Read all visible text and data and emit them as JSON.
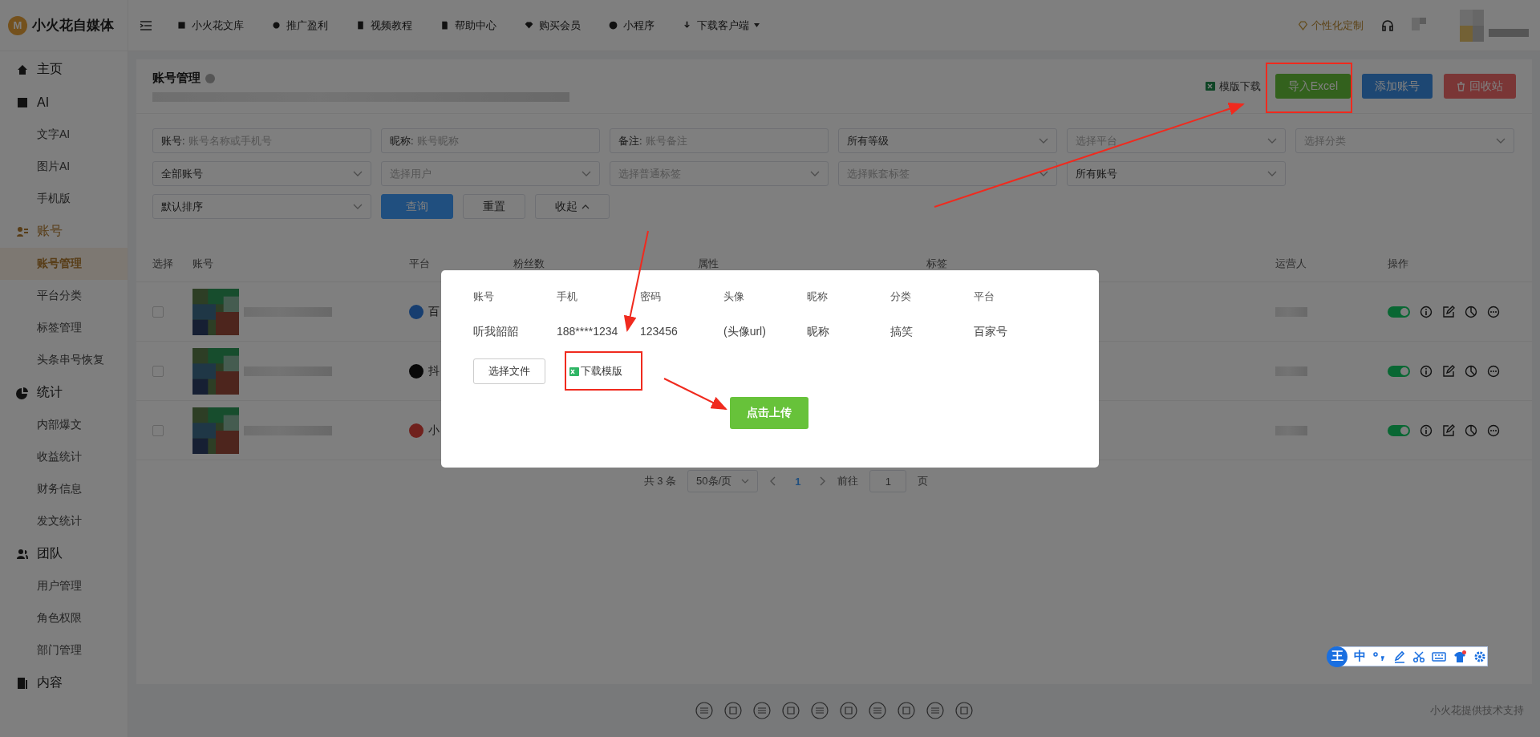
{
  "brand": {
    "name": "小火花自媒体",
    "logo": "M"
  },
  "nav": [
    {
      "label": "小火花文库"
    },
    {
      "label": "推广盈利"
    },
    {
      "label": "视频教程"
    },
    {
      "label": "帮助中心"
    },
    {
      "label": "购买会员"
    },
    {
      "label": "小程序"
    },
    {
      "label": "下载客户端",
      "dropdown": true
    }
  ],
  "custom": {
    "label": "个性化定制"
  },
  "sidebar": [
    {
      "label": "主页",
      "selected": false
    },
    {
      "label": "AI",
      "selected": false,
      "children": [
        {
          "label": "文字AI",
          "selected": false
        },
        {
          "label": "图片AI",
          "selected": false
        },
        {
          "label": "手机版",
          "selected": false
        }
      ]
    },
    {
      "label": "账号",
      "selected": true,
      "children": [
        {
          "label": "账号管理",
          "selected": true
        },
        {
          "label": "平台分类",
          "selected": false
        },
        {
          "label": "标签管理",
          "selected": false
        },
        {
          "label": "头条串号恢复",
          "selected": false
        }
      ]
    },
    {
      "label": "统计",
      "selected": false,
      "children": [
        {
          "label": "内部爆文",
          "selected": false
        },
        {
          "label": "收益统计",
          "selected": false
        },
        {
          "label": "财务信息",
          "selected": false
        },
        {
          "label": "发文统计",
          "selected": false
        }
      ]
    },
    {
      "label": "团队",
      "selected": false,
      "children": [
        {
          "label": "用户管理",
          "selected": false
        },
        {
          "label": "角色权限",
          "selected": false
        },
        {
          "label": "部门管理",
          "selected": false
        }
      ]
    },
    {
      "label": "内容",
      "selected": false
    }
  ],
  "header": {
    "title": "账号管理"
  },
  "actions": [
    {
      "label": "模版下载",
      "kind": "link"
    },
    {
      "label": "导入Excel",
      "kind": "success"
    },
    {
      "label": "添加账号",
      "kind": "primary"
    },
    {
      "label": "回收站",
      "kind": "danger"
    }
  ],
  "filters": [
    [
      {
        "kind": "input",
        "label": "账号:",
        "placeholder": "账号名称或手机号"
      },
      {
        "kind": "input",
        "label": "昵称:",
        "placeholder": "账号昵称"
      },
      {
        "kind": "input",
        "label": "备注:",
        "placeholder": "账号备注"
      },
      {
        "kind": "select",
        "value": "所有等级"
      },
      {
        "kind": "select",
        "placeholder": "选择平台"
      },
      {
        "kind": "select",
        "placeholder": "选择分类"
      }
    ],
    [
      {
        "kind": "select",
        "value": "全部账号"
      },
      {
        "kind": "select",
        "placeholder": "选择用户"
      },
      {
        "kind": "select",
        "placeholder": "选择普通标签"
      },
      {
        "kind": "select",
        "placeholder": "选择账套标签"
      },
      {
        "kind": "select",
        "value": "所有账号"
      }
    ],
    [
      {
        "kind": "select",
        "value": "默认排序"
      },
      {
        "kind": "primary",
        "label": "查询"
      },
      {
        "kind": "plain",
        "label": "重置"
      },
      {
        "kind": "toggle",
        "label": "收起"
      }
    ]
  ],
  "table": {
    "columns": [
      "选择",
      "账号",
      "平台",
      "粉丝数",
      "属性",
      "标签",
      "运营人",
      "操作"
    ],
    "rows": [
      {
        "checked": false,
        "platform": "百",
        "on": true
      },
      {
        "checked": false,
        "platform": "抖",
        "on": true
      },
      {
        "checked": false,
        "platform": "小",
        "on": true
      }
    ]
  },
  "pagination": {
    "total": "共 3 条",
    "page_size": "50条/页",
    "pages": [
      {
        "label": "1",
        "selected": true
      }
    ],
    "goto_label": "前往",
    "goto_value": "1",
    "suffix": "页"
  },
  "footer": {
    "credit": "小火花提供技术支持"
  },
  "modal": {
    "columns": [
      "账号",
      "手机",
      "密码",
      "头像",
      "昵称",
      "分类",
      "平台"
    ],
    "values": [
      "听我韶韶",
      "188****1234",
      "123456",
      "(头像url)",
      "昵称",
      "搞笑",
      "百家号"
    ],
    "file_button": "选择文件",
    "template_link": "下载模版",
    "upload_button": "点击上传"
  },
  "ime": {
    "logo": "王",
    "mode": "中"
  }
}
